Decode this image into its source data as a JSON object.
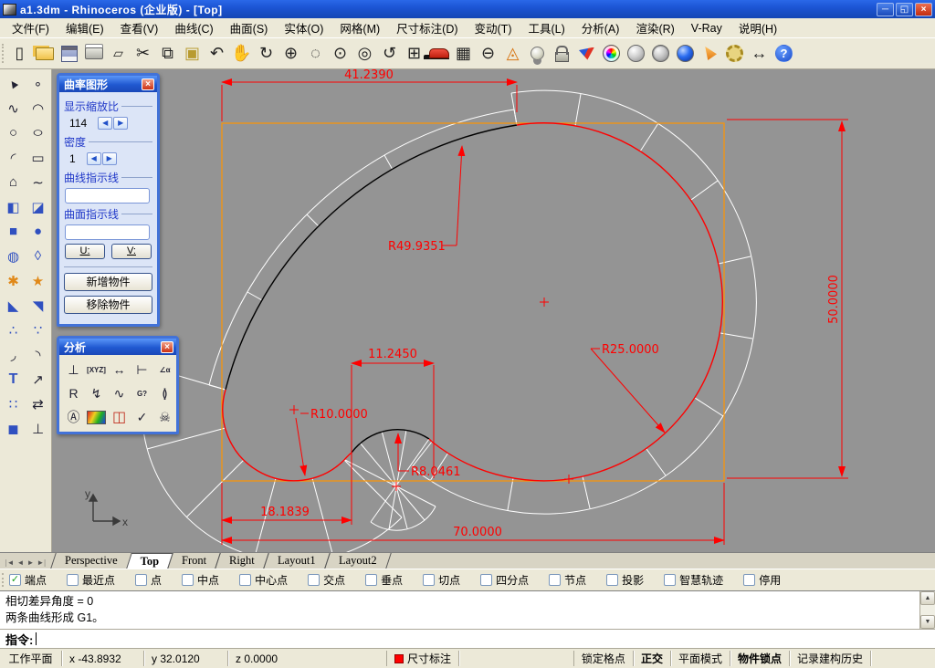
{
  "window": {
    "title": "a1.3dm - Rhinoceros (企业版) - [Top]",
    "minimize_glyph": "─",
    "restore_glyph": "◱",
    "close_glyph": "×"
  },
  "menu": {
    "items": [
      {
        "label": "文件(F)",
        "name": "menu-file"
      },
      {
        "label": "编辑(E)",
        "name": "menu-edit"
      },
      {
        "label": "查看(V)",
        "name": "menu-view"
      },
      {
        "label": "曲线(C)",
        "name": "menu-curve"
      },
      {
        "label": "曲面(S)",
        "name": "menu-surface"
      },
      {
        "label": "实体(O)",
        "name": "menu-solid"
      },
      {
        "label": "网格(M)",
        "name": "menu-mesh"
      },
      {
        "label": "尺寸标注(D)",
        "name": "menu-dimension"
      },
      {
        "label": "变动(T)",
        "name": "menu-transform"
      },
      {
        "label": "工具(L)",
        "name": "menu-tools"
      },
      {
        "label": "分析(A)",
        "name": "menu-analyze"
      },
      {
        "label": "渲染(R)",
        "name": "menu-render"
      },
      {
        "label": "V-Ray",
        "name": "menu-vray"
      },
      {
        "label": "说明(H)",
        "name": "menu-help"
      }
    ]
  },
  "toolbar": {
    "items": [
      {
        "name": "new-file-icon",
        "glyph": "▯",
        "cls": "big"
      },
      {
        "name": "open-file-icon",
        "glyph": "",
        "cls": "css-folder"
      },
      {
        "name": "save-icon",
        "glyph": "",
        "cls": "css-floppy"
      },
      {
        "name": "print-icon",
        "glyph": "",
        "cls": "css-printer"
      },
      {
        "name": "annotate-icon",
        "glyph": "▱",
        "cls": ""
      },
      {
        "name": "cut-icon",
        "glyph": "✂",
        "cls": "big"
      },
      {
        "name": "copy-icon",
        "glyph": "⧉",
        "cls": "big"
      },
      {
        "name": "paste-icon",
        "glyph": "▣",
        "cls": "yel big"
      },
      {
        "name": "undo-icon",
        "glyph": "↶",
        "cls": "big"
      },
      {
        "name": "pan-icon",
        "glyph": "✋",
        "cls": "big"
      },
      {
        "name": "rotate-view-icon",
        "glyph": "↻",
        "cls": "big"
      },
      {
        "name": "zoom-icon",
        "glyph": "⊕",
        "cls": "big"
      },
      {
        "name": "zoom-window-icon",
        "glyph": "◌",
        "cls": "big"
      },
      {
        "name": "zoom-extents-icon",
        "glyph": "⊙",
        "cls": "big"
      },
      {
        "name": "zoom-selected-icon",
        "glyph": "◎",
        "cls": "big"
      },
      {
        "name": "undo-view-icon",
        "glyph": "↺",
        "cls": "big"
      },
      {
        "name": "viewport-layout-icon",
        "glyph": "⊞",
        "cls": "big"
      },
      {
        "name": "move-car-icon",
        "glyph": "",
        "cls": "css-car"
      },
      {
        "name": "cplane-icon",
        "glyph": "▦",
        "cls": "big"
      },
      {
        "name": "circle-tool-icon",
        "glyph": "⊖",
        "cls": "big"
      },
      {
        "name": "layout-shapes-icon",
        "glyph": "◬",
        "cls": "org big"
      },
      {
        "name": "light-icon",
        "glyph": "",
        "cls": "css-bulb"
      },
      {
        "name": "lock-icon",
        "glyph": "",
        "cls": "css-lock"
      },
      {
        "name": "render-wedge-icon",
        "glyph": "",
        "cls": "css-wedge"
      },
      {
        "name": "color-wheel-icon",
        "glyph": "",
        "cls": "css-wheel"
      },
      {
        "name": "render-sphere-icon",
        "glyph": "",
        "cls": "css-sphere"
      },
      {
        "name": "wireframe-sphere-icon",
        "glyph": "",
        "cls": "css-sphere grid"
      },
      {
        "name": "shaded-sphere-icon",
        "glyph": "",
        "cls": "css-sphere blue"
      },
      {
        "name": "notify-cone-icon",
        "glyph": "",
        "cls": "css-cone"
      },
      {
        "name": "options-gear-icon",
        "glyph": "",
        "cls": "css-gear"
      },
      {
        "name": "dimension-tool-icon",
        "glyph": "↔",
        "cls": "big"
      },
      {
        "name": "help-icon",
        "glyph": "?",
        "cls": "css-help"
      }
    ]
  },
  "sidebar": {
    "items": [
      {
        "name": "select-icon",
        "glyph": "▲",
        "cls": "rot"
      },
      {
        "name": "point-icon",
        "glyph": "∘",
        "cls": ""
      },
      {
        "name": "curve-icon",
        "glyph": "∿",
        "cls": ""
      },
      {
        "name": "curve-handles-icon",
        "glyph": "◠",
        "cls": ""
      },
      {
        "name": "circle-icon",
        "glyph": "○",
        "cls": ""
      },
      {
        "name": "ellipse-icon",
        "glyph": "○",
        "cls": "ell"
      },
      {
        "name": "arc-icon",
        "glyph": "◜",
        "cls": ""
      },
      {
        "name": "rectangle-icon",
        "glyph": "▭",
        "cls": ""
      },
      {
        "name": "polygon-icon",
        "glyph": "⌂",
        "cls": ""
      },
      {
        "name": "freeform-curve-icon",
        "glyph": "∼",
        "cls": ""
      },
      {
        "name": "surface-points-icon",
        "glyph": "◧",
        "cls": "blu"
      },
      {
        "name": "curved-surface-icon",
        "glyph": "◪",
        "cls": "blu"
      },
      {
        "name": "box-icon",
        "glyph": "■",
        "cls": "blu"
      },
      {
        "name": "sphere-icon",
        "glyph": "●",
        "cls": "blu"
      },
      {
        "name": "torus-icon",
        "glyph": "◍",
        "cls": "blu"
      },
      {
        "name": "patch-icon",
        "glyph": "◊",
        "cls": "blu"
      },
      {
        "name": "explode-icon",
        "glyph": "✱",
        "cls": "org"
      },
      {
        "name": "flash-icon",
        "glyph": "★",
        "cls": "org"
      },
      {
        "name": "trim-icon",
        "glyph": "◣",
        "cls": "blu"
      },
      {
        "name": "split-icon",
        "glyph": "◥",
        "cls": "blu"
      },
      {
        "name": "boolean-union-icon",
        "glyph": "∴",
        "cls": "blu"
      },
      {
        "name": "boolean-difference-icon",
        "glyph": "∵",
        "cls": "blu"
      },
      {
        "name": "fillet-curve-icon",
        "glyph": "◞",
        "cls": ""
      },
      {
        "name": "extend-curve-icon",
        "glyph": "◝",
        "cls": ""
      },
      {
        "name": "text-icon",
        "glyph": "T",
        "cls": "blu bold"
      },
      {
        "name": "move-icon",
        "glyph": "↗",
        "cls": ""
      },
      {
        "name": "array-icon",
        "glyph": "∷",
        "cls": "blu"
      },
      {
        "name": "orient-icon",
        "glyph": "⇄",
        "cls": ""
      },
      {
        "name": "cube-icon",
        "glyph": "◼",
        "cls": "blu"
      },
      {
        "name": "measure-icon",
        "glyph": "⊥",
        "cls": ""
      }
    ]
  },
  "curvature_panel": {
    "title": "曲率图形",
    "close_glyph": "×",
    "scale_label": "显示缩放比",
    "scale_value": "114",
    "density_label": "密度",
    "density_value": "1",
    "curve_hair_label": "曲线指示线",
    "curve_hair_value": "",
    "surface_hair_label": "曲面指示线",
    "surface_hair_value": "",
    "u_button": "U:",
    "v_button": "V:",
    "add_button": "新增物件",
    "remove_button": "移除物件",
    "spin_left": "◀",
    "spin_right": "▶"
  },
  "analysis_panel": {
    "title": "分析",
    "close_glyph": "×",
    "tools": [
      {
        "name": "point-eval-icon",
        "glyph": "⊥",
        "cls": ""
      },
      {
        "name": "xyz-coords-icon",
        "glyph": "[XYZ]",
        "cls": "tiny"
      },
      {
        "name": "distance-icon",
        "glyph": "↔",
        "cls": ""
      },
      {
        "name": "length-icon",
        "glyph": "⊢",
        "cls": ""
      },
      {
        "name": "angle-icon",
        "glyph": "∠α",
        "cls": "tiny"
      },
      {
        "name": "radius-icon",
        "glyph": "R",
        "cls": ""
      },
      {
        "name": "direction-icon",
        "glyph": "↯",
        "cls": ""
      },
      {
        "name": "curvature-graph-icon",
        "glyph": "∿",
        "cls": ""
      },
      {
        "name": "continuity-icon",
        "glyph": "G?",
        "cls": "tiny"
      },
      {
        "name": "symmetry-icon",
        "glyph": "≬",
        "cls": ""
      },
      {
        "name": "area-icon",
        "glyph": "Ⓐ",
        "cls": ""
      },
      {
        "name": "surface-analysis-icon",
        "glyph": "",
        "cls": "rainbow"
      },
      {
        "name": "volume-icon",
        "glyph": "◫",
        "cls": "redgreen"
      },
      {
        "name": "check-icon",
        "glyph": "✓",
        "cls": ""
      },
      {
        "name": "naked-edges-icon",
        "glyph": "☠",
        "cls": ""
      }
    ]
  },
  "viewport": {
    "dims": {
      "w41": "41.2390",
      "r49": "R49.9351",
      "h50": "50.0000",
      "w11": "11.2450",
      "r25": "R25.0000",
      "r10": "R10.0000",
      "r8": "R8.0461",
      "w18": "18.1839",
      "w70": "70.0000"
    },
    "axis": {
      "x": "x",
      "y": "y"
    }
  },
  "view_tabs": {
    "nav": [
      {
        "name": "first-tab-button",
        "glyph": "|◄"
      },
      {
        "name": "prev-tab-button",
        "glyph": "◄"
      },
      {
        "name": "next-tab-button",
        "glyph": "►"
      },
      {
        "name": "last-tab-button",
        "glyph": "►|"
      }
    ],
    "tabs": [
      {
        "label": "Perspective",
        "name": "tab-perspective",
        "active": false
      },
      {
        "label": "Top",
        "name": "tab-top",
        "active": true
      },
      {
        "label": "Front",
        "name": "tab-front",
        "active": false
      },
      {
        "label": "Right",
        "name": "tab-right",
        "active": false
      },
      {
        "label": "Layout1",
        "name": "tab-layout1",
        "active": false
      },
      {
        "label": "Layout2",
        "name": "tab-layout2",
        "active": false
      }
    ]
  },
  "osnap": {
    "items": [
      {
        "label": "端点",
        "checked": true
      },
      {
        "label": "最近点",
        "checked": false
      },
      {
        "label": "点",
        "checked": false
      },
      {
        "label": "中点",
        "checked": false
      },
      {
        "label": "中心点",
        "checked": false
      },
      {
        "label": "交点",
        "checked": false
      },
      {
        "label": "垂点",
        "checked": false
      },
      {
        "label": "切点",
        "checked": false
      },
      {
        "label": "四分点",
        "checked": false
      },
      {
        "label": "节点",
        "checked": false
      },
      {
        "label": "投影",
        "checked": false
      },
      {
        "label": "智慧轨迹",
        "checked": false
      },
      {
        "label": "停用",
        "checked": false
      }
    ]
  },
  "command": {
    "history": [
      {
        "text": "相切差异角度 = 0"
      },
      {
        "text": "两条曲线形成 G1。"
      }
    ],
    "prompt": "指令:",
    "scroll_up": "▲",
    "scroll_down": "▼"
  },
  "status": {
    "cplane": "工作平面",
    "x": "x -43.8932",
    "y": "y 32.0120",
    "z": "z 0.0000",
    "layer": "尺寸标注",
    "grid_snap": "锁定格点",
    "ortho": "正交",
    "planar": "平面模式",
    "osnap": "物件锁点",
    "record": "记录建构历史"
  },
  "colors": {
    "dimension_red": "#ff0000",
    "rect_orange": "#ff9400",
    "viewport_gray": "#949494",
    "titlebar_blue": "#1c55d4",
    "comb_white": "#ffffff",
    "curve_black": "#000000"
  }
}
